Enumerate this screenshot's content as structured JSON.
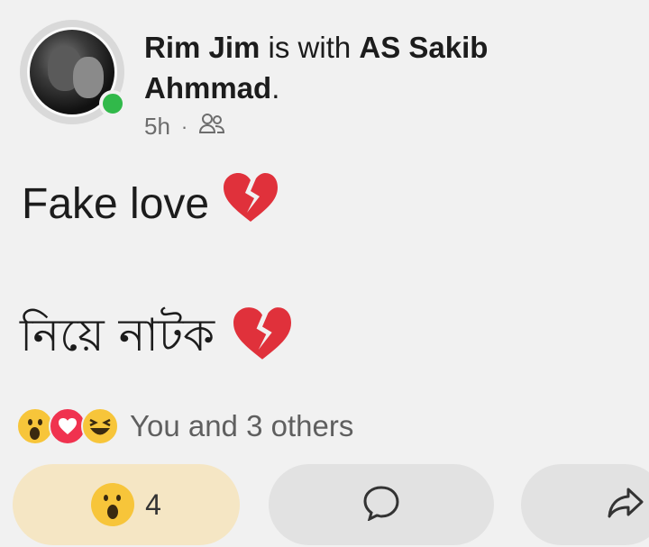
{
  "post": {
    "author": "Rim Jim",
    "with_text": " is with ",
    "tagged": "AS Sakib Ahmmad",
    "period": ".",
    "time": "5h",
    "separator": "·",
    "audience_icon": "friends-icon",
    "line1": "Fake love",
    "line2": "নিয়ে নাটক",
    "emoji": "💔"
  },
  "reactions": {
    "icons": [
      "wow-icon",
      "love-icon",
      "haha-icon"
    ],
    "summary": "You and 3 others"
  },
  "actions": {
    "react_count": "4",
    "comment_icon": "comment-icon",
    "share_icon": "share-icon"
  },
  "colors": {
    "online": "#31b94a",
    "react_active_bg": "#f5e6c4",
    "button_bg": "#e2e2e2",
    "love": "#f0324f",
    "wow": "#f7c53a"
  }
}
